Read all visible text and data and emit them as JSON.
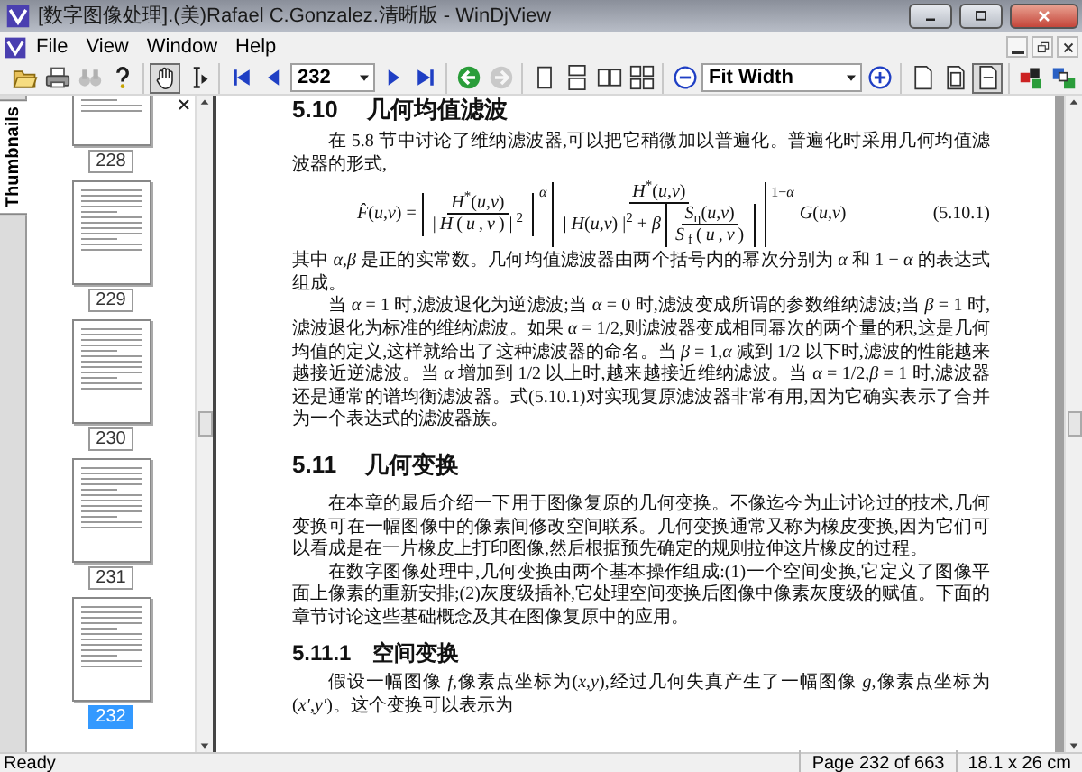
{
  "window": {
    "title": "[数字图像处理].(美)Rafael C.Gonzalez.清晰版 - WinDjView"
  },
  "menu": [
    "File",
    "View",
    "Window",
    "Help"
  ],
  "toolbar": [
    [
      {
        "kind": "open",
        "pressed": false,
        "disabled": false
      },
      {
        "kind": "print",
        "pressed": false,
        "disabled": false
      },
      {
        "kind": "find",
        "pressed": false,
        "disabled": true
      },
      {
        "kind": "help",
        "pressed": false,
        "disabled": false
      }
    ],
    [
      {
        "kind": "hand",
        "pressed": true,
        "disabled": false
      },
      {
        "kind": "select",
        "pressed": false,
        "disabled": false
      }
    ],
    [
      {
        "kind": "first",
        "pressed": false,
        "disabled": false
      },
      {
        "kind": "prev",
        "pressed": false,
        "disabled": false
      },
      {
        "kind": "combo",
        "value": "232"
      },
      {
        "kind": "next",
        "pressed": false,
        "disabled": false
      },
      {
        "kind": "last",
        "pressed": false,
        "disabled": false
      }
    ],
    [
      {
        "kind": "back",
        "pressed": false,
        "disabled": false
      },
      {
        "kind": "forward",
        "pressed": false,
        "disabled": true
      }
    ],
    [
      {
        "kind": "single",
        "pressed": false,
        "disabled": false
      },
      {
        "kind": "continuous",
        "pressed": false,
        "disabled": false
      },
      {
        "kind": "facing",
        "pressed": false,
        "disabled": false
      },
      {
        "kind": "facing-continuous",
        "pressed": false,
        "disabled": false
      }
    ],
    [
      {
        "kind": "zoom-out",
        "pressed": false,
        "disabled": false
      },
      {
        "kind": "combo",
        "value": "Fit Width"
      },
      {
        "kind": "zoom-in",
        "pressed": false,
        "disabled": false
      }
    ],
    [
      {
        "kind": "actual-size",
        "pressed": false,
        "disabled": false
      },
      {
        "kind": "fit-page",
        "pressed": false,
        "disabled": false
      },
      {
        "kind": "fit-width",
        "pressed": true,
        "disabled": false
      }
    ],
    [
      {
        "kind": "color",
        "pressed": false,
        "disabled": false
      },
      {
        "kind": "display",
        "pressed": false,
        "disabled": false
      }
    ]
  ],
  "sidebar": {
    "tab": "Thumbnails",
    "thumbnails": [
      {
        "label": "228",
        "selected": false
      },
      {
        "label": "229",
        "selected": false
      },
      {
        "label": "230",
        "selected": false
      },
      {
        "label": "231",
        "selected": false
      },
      {
        "label": "232",
        "selected": true
      }
    ]
  },
  "page": {
    "blocks": [
      {
        "kind": "heading",
        "number": "5.10",
        "title": "几何均值滤波"
      },
      {
        "kind": "paragraph",
        "indent": true,
        "text": "在 5.8 节中讨论了维纳滤波器,可以把它稍微加以普遍化。普遍化时采用几何均值滤波器的形式,"
      },
      {
        "kind": "equation",
        "lhs": "*F̂*(*u*,*v*) =",
        "num1": "*H*$^{*}$(*u*,*v*)",
        "den1": "| *H*(*u*,*v*) |$^{2}$",
        "power1": "*α*",
        "num2": "*H*$^{*}$(*u*,*v*)",
        "den2": "| *H*(*u*,*v*) |$^{2}$ + *β*",
        "inner_num": "*S*$_{η}$(*u*,*v*)",
        "inner_den": "*S*$_{f}$(*u*,*v*)",
        "power2": "1−*α*",
        "rhs": "*G*(*u*,*v*)",
        "number": "(5.10.1)"
      },
      {
        "kind": "paragraph",
        "indent": false,
        "text": "其中 *α*,*β* 是正的实常数。几何均值滤波器由两个括号内的幂次分别为 *α* 和 1 − *α* 的表达式组成。"
      },
      {
        "kind": "paragraph",
        "indent": true,
        "text": "当 *α* = 1 时,滤波退化为逆滤波;当 *α* = 0 时,滤波变成所谓的参数维纳滤波;当 *β* = 1 时,滤波退化为标准的维纳滤波。如果 *α* = 1/2,则滤波器变成相同幂次的两个量的积,这是几何均值的定义,这样就给出了这种滤波器的命名。当 *β* = 1,*α* 减到 1/2 以下时,滤波的性能越来越接近逆滤波。当 *α* 增加到 1/2 以上时,越来越接近维纳滤波。当 *α* = 1/2,*β* = 1 时,滤波器还是通常的谱均衡滤波器。式(5.10.1)对实现复原滤波器非常有用,因为它确实表示了合并为一个表达式的滤波器族。"
      },
      {
        "kind": "heading",
        "number": "5.11",
        "title": "几何变换"
      },
      {
        "kind": "paragraph",
        "indent": true,
        "text": "在本章的最后介绍一下用于图像复原的几何变换。不像迄今为止讨论过的技术,几何变换可在一幅图像中的像素间修改空间联系。几何变换通常又称为橡皮变换,因为它们可以看成是在一片橡皮上打印图像,然后根据预先确定的规则拉伸这片橡皮的过程。"
      },
      {
        "kind": "paragraph",
        "indent": true,
        "text": "在数字图像处理中,几何变换由两个基本操作组成:(1)一个空间变换,它定义了图像平面上像素的重新安排;(2)灰度级插补,它处理空间变换后图像中像素灰度级的赋值。下面的章节讨论这些基础概念及其在图像复原中的应用。"
      },
      {
        "kind": "subheading",
        "number": "5.11.1",
        "title": "空间变换"
      },
      {
        "kind": "paragraph",
        "indent": true,
        "text": "假设一幅图像 *f*,像素点坐标为(*x*,*y*),经过几何失真产生了一幅图像 *g*,像素点坐标为(*x′*,*y′*)。这个变换可以表示为"
      }
    ]
  },
  "status_bar": [
    "Ready",
    "Page 232 of 663",
    "18.1 x 26 cm"
  ]
}
